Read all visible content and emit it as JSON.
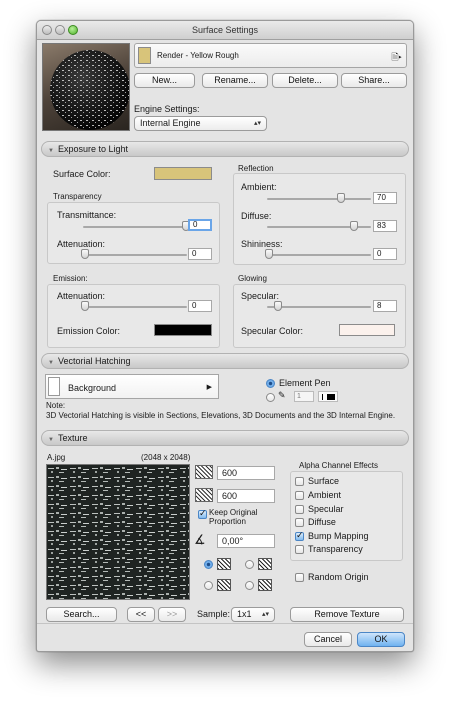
{
  "window": {
    "title": "Surface Settings"
  },
  "surface": {
    "name": "Render - Yellow Rough",
    "swatch_color": "#d8c47a"
  },
  "buttons": {
    "new": "New...",
    "rename": "Rename...",
    "delete": "Delete...",
    "share": "Share..."
  },
  "engine": {
    "label": "Engine Settings:",
    "value": "Internal Engine"
  },
  "exposure": {
    "title": "Exposure to Light",
    "surface_color_label": "Surface Color:",
    "surface_color": "#d8c47a",
    "transparency": {
      "title": "Transparency",
      "transmittance_label": "Transmittance:",
      "transmittance": "0",
      "attenuation_label": "Attenuation:",
      "attenuation": "0"
    },
    "reflection": {
      "title": "Reflection",
      "ambient_label": "Ambient:",
      "ambient": "70",
      "diffuse_label": "Diffuse:",
      "diffuse": "83",
      "shininess_label": "Shininess:",
      "shininess": "0"
    },
    "emission": {
      "title": "Emission:",
      "attenuation_label": "Attenuation:",
      "attenuation": "0",
      "color_label": "Emission Color:",
      "color": "#000000"
    },
    "glowing": {
      "title": "Glowing",
      "specular_label": "Specular:",
      "specular": "8",
      "color_label": "Specular Color:",
      "color": "#fbf1ec"
    }
  },
  "hatching": {
    "title": "Vectorial Hatching",
    "background_label": "Background",
    "element_pen_label": "Element Pen",
    "pen_number": "1",
    "note_label": "Note:",
    "note": "3D Vectorial Hatching is visible in Sections, Elevations, 3D Documents and the 3D Internal Engine."
  },
  "texture": {
    "title": "Texture",
    "file_name": "A.jpg",
    "file_size": "(2048 x 2048)",
    "width": "600",
    "height": "600",
    "keep_proportion": "Keep Original Proportion",
    "angle": "0,00°",
    "search_button": "Search...",
    "prev_button": "<<",
    "next_button": ">>",
    "sample_label": "Sample:",
    "sample_value": "1x1",
    "remove_button": "Remove Texture",
    "random_origin": "Random Origin",
    "alpha": {
      "title": "Alpha Channel Effects",
      "items": [
        {
          "label": "Surface",
          "checked": false
        },
        {
          "label": "Ambient",
          "checked": false
        },
        {
          "label": "Specular",
          "checked": false
        },
        {
          "label": "Diffuse",
          "checked": false
        },
        {
          "label": "Bump Mapping",
          "checked": true
        },
        {
          "label": "Transparency",
          "checked": false
        }
      ]
    }
  },
  "footer": {
    "cancel": "Cancel",
    "ok": "OK"
  }
}
